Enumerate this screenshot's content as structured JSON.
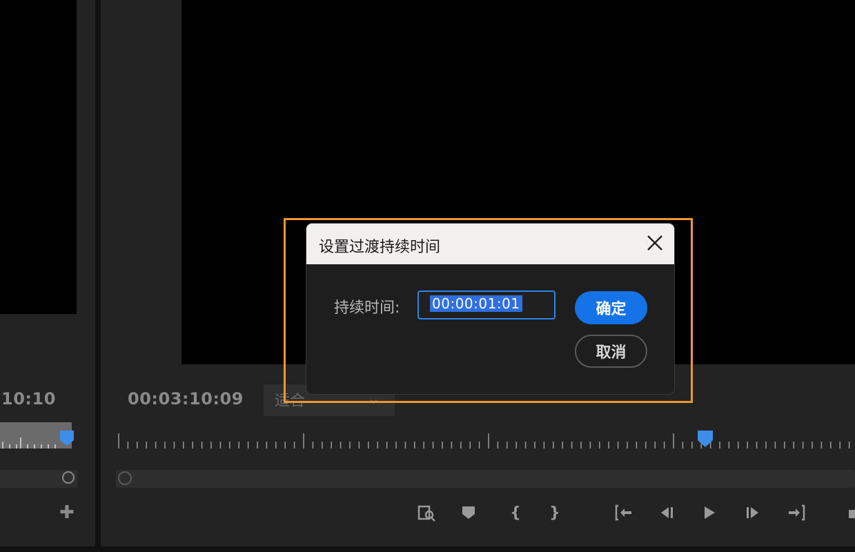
{
  "source_monitor": {
    "timecode": "10:10"
  },
  "program_monitor": {
    "timecode": "00:03:10:09",
    "fit_dropdown": {
      "selected": "适合"
    },
    "playhead_position": 0.795
  },
  "dialog": {
    "title": "设置过渡持续时间",
    "duration_label": "持续时间:",
    "duration_value": "00:00:01:01",
    "ok_label": "确定",
    "cancel_label": "取消"
  },
  "transport": {
    "icons": [
      "export-frame-icon",
      "add-marker-icon",
      "mark-in-icon",
      "mark-out-icon",
      "go-to-in-icon",
      "step-back-icon",
      "play-icon",
      "step-forward-icon",
      "go-to-out-icon"
    ]
  },
  "colors": {
    "accent": "#1473e6",
    "highlight": "#f0962e",
    "playhead": "#3d8ee8"
  }
}
